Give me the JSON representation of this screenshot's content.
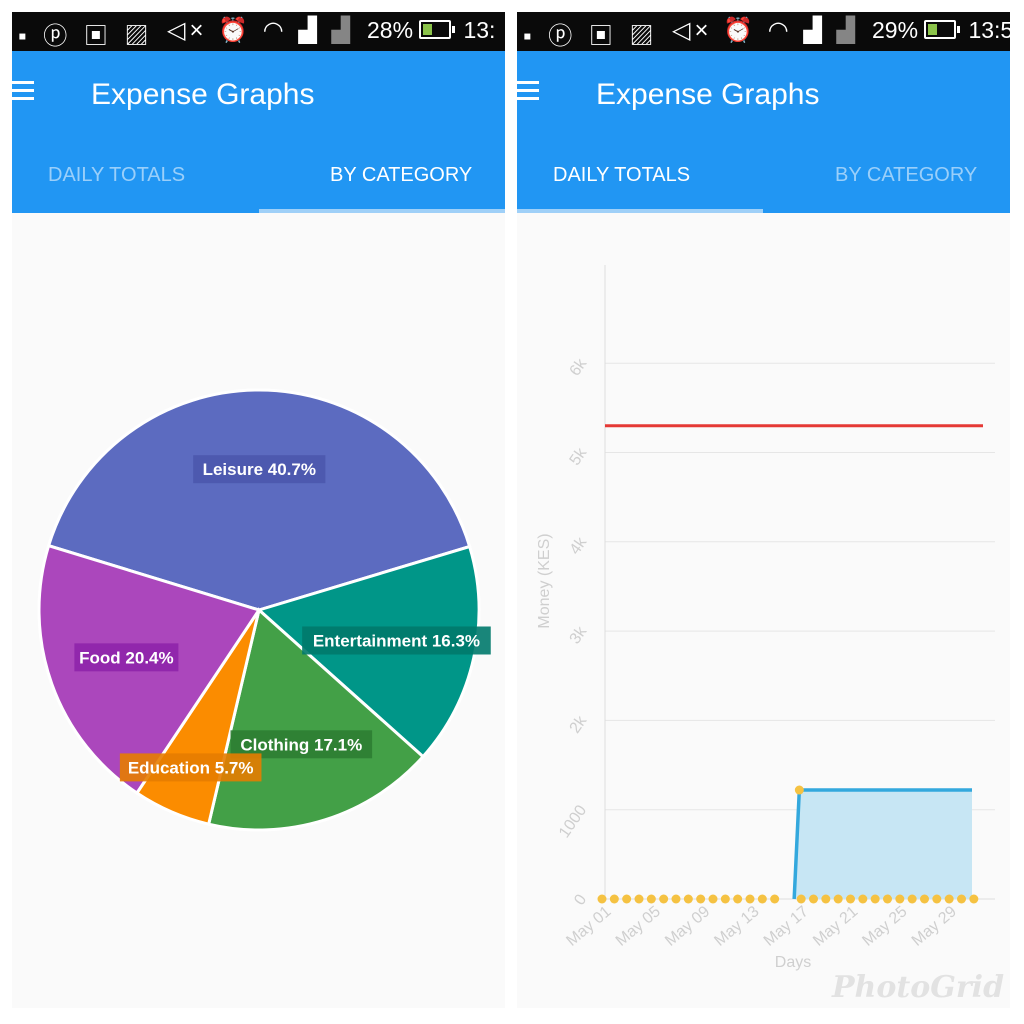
{
  "panels": [
    {
      "status_bar": {
        "left_icons": [
          "pinterest-icon",
          "chat-icon",
          "image-icon",
          "mute-icon",
          "alarm-icon",
          "wifi-icon",
          "signal-icon",
          "signal-icon"
        ],
        "battery": "28%",
        "time": "13:"
      },
      "app_bar": {
        "title": "Expense Graphs",
        "tabs": [
          {
            "label": "DAILY TOTALS",
            "active": false
          },
          {
            "label": "BY CATEGORY",
            "active": true
          }
        ]
      }
    },
    {
      "status_bar": {
        "left_icons": [
          "pinterest-icon",
          "chat-icon",
          "image-icon",
          "mute-icon",
          "alarm-icon",
          "wifi-icon",
          "signal-icon",
          "signal-icon"
        ],
        "battery": "29%",
        "time": "13:5"
      },
      "app_bar": {
        "title": "Expense Graphs",
        "tabs": [
          {
            "label": "DAILY TOTALS",
            "active": true
          },
          {
            "label": "BY CATEGORY",
            "active": false
          }
        ]
      }
    }
  ],
  "watermark": "PhotoGrid",
  "colors": {
    "app_bar": "#2196f3",
    "leisure": "#5c6bc0",
    "entertainment": "#009688",
    "clothing": "#43a047",
    "education": "#fb8c00",
    "food": "#ab47bc",
    "budget_line": "#e53935",
    "daily_line": "#33a8dd",
    "point": "#f5c242"
  },
  "chart_data": [
    {
      "type": "pie",
      "slices": [
        {
          "label": "Leisure 40.7%",
          "name": "Leisure",
          "value": 40.7
        },
        {
          "label": "Entertainment 16.3%",
          "name": "Entertainment",
          "value": 16.3
        },
        {
          "label": "Clothing 17.1%",
          "name": "Clothing",
          "value": 17.1
        },
        {
          "label": "Education 5.7%",
          "name": "Education",
          "value": 5.7
        },
        {
          "label": "Food 20.4%",
          "name": "Food",
          "value": 20.4
        }
      ]
    },
    {
      "type": "area",
      "xlabel": "Days",
      "ylabel": "Money (KES)",
      "ylim": [
        0,
        7000
      ],
      "yticks": [
        0,
        1000,
        2000,
        3000,
        4000,
        5000,
        6000
      ],
      "ytick_labels": [
        "0",
        "1000",
        "2k",
        "3k",
        "4k",
        "5k",
        "6k"
      ],
      "xtick_labels": [
        "May 01",
        "May 05",
        "May 09",
        "May 13",
        "May 17",
        "May 21",
        "May 25",
        "May 29"
      ],
      "grid": true,
      "series": [
        {
          "kind": "reference-line",
          "x_from": "May 01",
          "x_to": "May 31",
          "value": 5300
        },
        {
          "kind": "daily-total",
          "x": [
            "May 01",
            "May 02",
            "May 03",
            "May 04",
            "May 05",
            "May 06",
            "May 07",
            "May 08",
            "May 09",
            "May 10",
            "May 11",
            "May 12",
            "May 13",
            "May 14",
            "May 15",
            "May 16",
            "May 17",
            "May 18",
            "May 19",
            "May 20",
            "May 21",
            "May 22",
            "May 23",
            "May 24",
            "May 25",
            "May 26",
            "May 27",
            "May 28",
            "May 29",
            "May 30",
            "May 31"
          ],
          "values": [
            0,
            0,
            0,
            0,
            0,
            0,
            0,
            0,
            0,
            0,
            0,
            0,
            0,
            0,
            0,
            0,
            1220,
            1220,
            1220,
            1220,
            1220,
            1220,
            1220,
            1220,
            1220,
            1220,
            1220,
            1220,
            1220,
            1220,
            1220
          ],
          "marker_values": [
            0,
            0,
            0,
            0,
            0,
            0,
            0,
            0,
            0,
            0,
            0,
            0,
            0,
            0,
            0,
            1220,
            0,
            0,
            0,
            0,
            0,
            0,
            0,
            0,
            0,
            0,
            0,
            0,
            0,
            0,
            0
          ]
        }
      ]
    }
  ]
}
